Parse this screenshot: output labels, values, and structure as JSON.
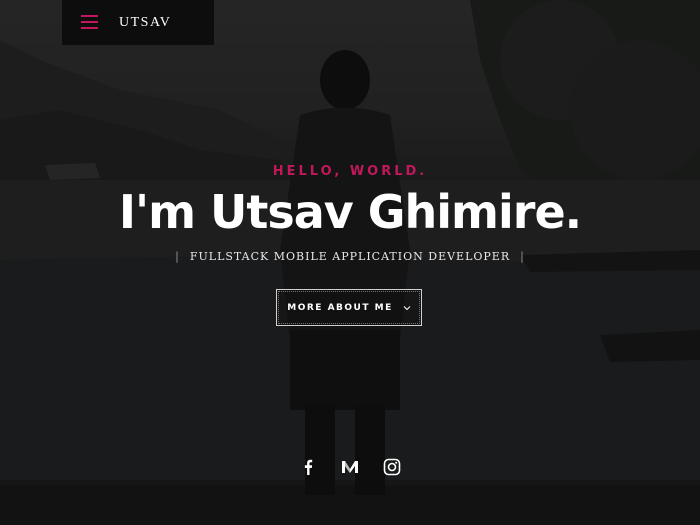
{
  "header": {
    "logo": "UTSAV",
    "menu_icon": "hamburger-menu-icon",
    "accent_color": "#c2185b"
  },
  "hero": {
    "greeting": "HELLO, WORLD.",
    "title": "I'm Utsav Ghimire.",
    "subtitle": "FULLSTACK MOBILE APPLICATION DEVELOPER",
    "cta_label": "MORE ABOUT ME",
    "cta_icon": "chevron-down-icon"
  },
  "social": [
    {
      "icon": "facebook-icon"
    },
    {
      "icon": "medium-icon"
    },
    {
      "icon": "instagram-icon"
    }
  ]
}
